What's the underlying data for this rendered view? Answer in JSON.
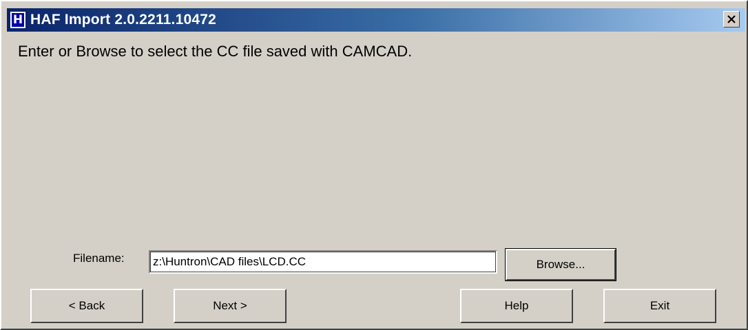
{
  "window": {
    "title": "HAF Import 2.0.2211.10472",
    "app_icon_letter": "H",
    "accent_color": "#0a246a"
  },
  "main": {
    "instruction": "Enter or Browse to select the CC file saved with CAMCAD."
  },
  "filename": {
    "label": "Filename:",
    "value": "z:\\Huntron\\CAD files\\LCD.CC"
  },
  "buttons": {
    "browse": "Browse...",
    "back": "< Back",
    "next": "Next >",
    "help": "Help",
    "exit": "Exit"
  },
  "icons": {
    "close": "close-icon",
    "app": "app-icon"
  }
}
